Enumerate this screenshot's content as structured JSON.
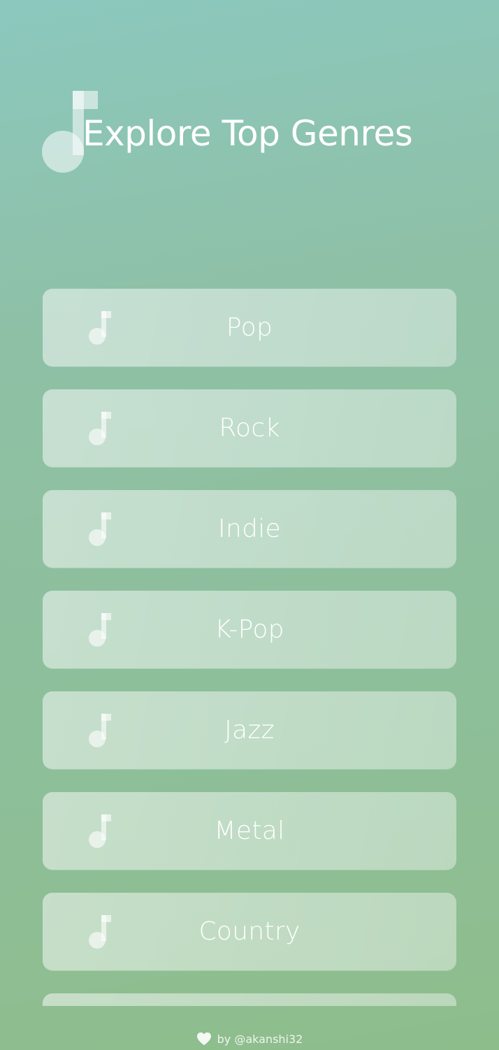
{
  "header": {
    "title": "Explore Top Genres",
    "icon": "music-note-icon"
  },
  "genres": [
    {
      "label": "Pop",
      "icon": "music-note-icon"
    },
    {
      "label": "Rock",
      "icon": "music-note-icon"
    },
    {
      "label": "Indie",
      "icon": "music-note-icon"
    },
    {
      "label": "K-Pop",
      "icon": "music-note-icon"
    },
    {
      "label": "Jazz",
      "icon": "music-note-icon"
    },
    {
      "label": "Metal",
      "icon": "music-note-icon"
    },
    {
      "label": "Country",
      "icon": "music-note-icon"
    },
    {
      "label": "",
      "icon": "music-note-icon"
    }
  ],
  "footer": {
    "icon": "heart-icon",
    "text": "by @akanshi32"
  },
  "colors": {
    "background_top": "#8cc8be",
    "background_bottom": "#8ebd8c",
    "text": "#ffffff",
    "card": "rgba(255,255,255,0.45)"
  }
}
